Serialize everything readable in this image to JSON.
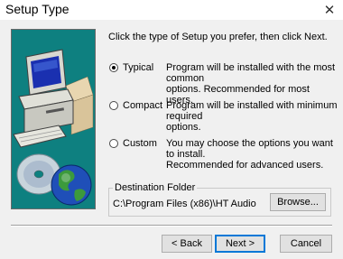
{
  "window": {
    "title": "Setup Type",
    "close_glyph": "✕"
  },
  "instructions": "Click the type of Setup you prefer, then click Next.",
  "options": [
    {
      "label": "Typical",
      "selected": true,
      "desc_line1": "Program will be installed with the most common",
      "desc_line2": "options. Recommended for most users."
    },
    {
      "label": "Compact",
      "selected": false,
      "desc_line1": "Program will be installed with minimum required",
      "desc_line2": "options."
    },
    {
      "label": "Custom",
      "selected": false,
      "desc_line1": "You may choose the options you want to install.",
      "desc_line2": "Recommended for advanced users."
    }
  ],
  "destination": {
    "group_label": "Destination Folder",
    "path": "C:\\Program Files (x86)\\HT Audio",
    "browse_label": "Browse..."
  },
  "buttons": {
    "back_label": "< Back",
    "next_label": "Next >",
    "cancel_label": "Cancel"
  },
  "colors": {
    "art_background": "#0e8080",
    "default_button_border": "#0078d7"
  },
  "icons": [
    "close-icon",
    "computer-illustration-icon",
    "cd-disc-icon",
    "globe-icon"
  ]
}
